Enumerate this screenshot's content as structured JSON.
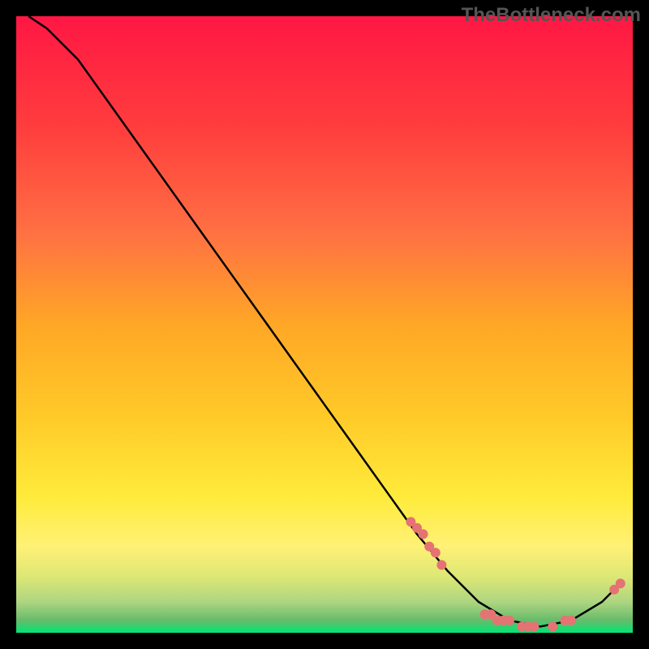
{
  "watermark": "TheBottleneck.com",
  "chart_data": {
    "type": "line",
    "title": "",
    "xlabel": "",
    "ylabel": "",
    "xlim": [
      0,
      100
    ],
    "ylim": [
      0,
      100
    ],
    "curve": [
      {
        "x": 2,
        "y": 100
      },
      {
        "x": 5,
        "y": 98
      },
      {
        "x": 10,
        "y": 93
      },
      {
        "x": 15,
        "y": 86
      },
      {
        "x": 20,
        "y": 79
      },
      {
        "x": 25,
        "y": 72
      },
      {
        "x": 30,
        "y": 65
      },
      {
        "x": 35,
        "y": 58
      },
      {
        "x": 40,
        "y": 51
      },
      {
        "x": 45,
        "y": 44
      },
      {
        "x": 50,
        "y": 37
      },
      {
        "x": 55,
        "y": 30
      },
      {
        "x": 60,
        "y": 23
      },
      {
        "x": 65,
        "y": 16
      },
      {
        "x": 70,
        "y": 10
      },
      {
        "x": 75,
        "y": 5
      },
      {
        "x": 80,
        "y": 2
      },
      {
        "x": 85,
        "y": 1
      },
      {
        "x": 90,
        "y": 2
      },
      {
        "x": 95,
        "y": 5
      },
      {
        "x": 98,
        "y": 8
      }
    ],
    "points": [
      {
        "x": 64,
        "y": 18
      },
      {
        "x": 65,
        "y": 17
      },
      {
        "x": 66,
        "y": 16
      },
      {
        "x": 67,
        "y": 14
      },
      {
        "x": 68,
        "y": 13
      },
      {
        "x": 69,
        "y": 11
      },
      {
        "x": 76,
        "y": 3
      },
      {
        "x": 77,
        "y": 3
      },
      {
        "x": 78,
        "y": 2
      },
      {
        "x": 79,
        "y": 2
      },
      {
        "x": 80,
        "y": 2
      },
      {
        "x": 82,
        "y": 1
      },
      {
        "x": 83,
        "y": 1
      },
      {
        "x": 84,
        "y": 1
      },
      {
        "x": 87,
        "y": 1
      },
      {
        "x": 89,
        "y": 2
      },
      {
        "x": 90,
        "y": 2
      },
      {
        "x": 97,
        "y": 7
      },
      {
        "x": 98,
        "y": 8
      }
    ],
    "gradient_colors": {
      "top": "#ff1744",
      "upper_mid": "#ff6d3a",
      "mid": "#ffc107",
      "lower_mid": "#ffeb3b",
      "lower": "#cddc39",
      "bottom": "#00e676"
    },
    "point_color": "#e57373",
    "line_color": "#000000"
  }
}
